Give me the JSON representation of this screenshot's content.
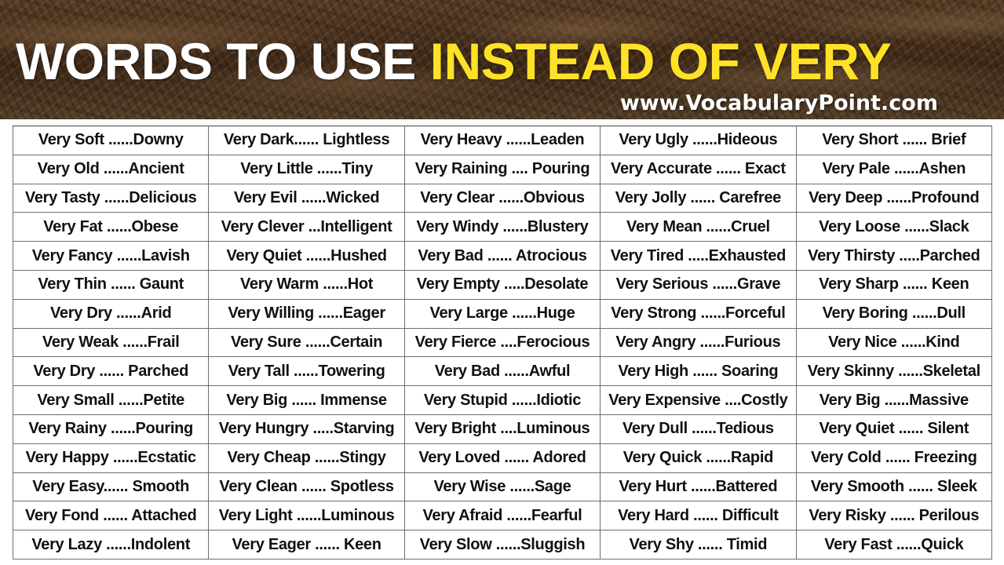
{
  "header": {
    "title_white": "WORDS TO USE",
    "title_yellow": "INSTEAD OF VERY",
    "website": "www.VocabularyPoint.com"
  },
  "colors": {
    "title_white": "#ffffff",
    "title_yellow": "#ffe227",
    "banner_brown": "#4a3220",
    "table_border": "#6e6e6e",
    "text": "#111111"
  },
  "table": {
    "rows": [
      [
        "Very Soft ......Downy",
        "Very Dark...... Lightless",
        "Very Heavy ......Leaden",
        "Very Ugly ......Hideous",
        "Very Short ...... Brief"
      ],
      [
        "Very Old ......Ancient",
        "Very Little ......Tiny",
        "Very Raining .... Pouring",
        "Very Accurate ...... Exact",
        "Very Pale ......Ashen"
      ],
      [
        "Very Tasty ......Delicious",
        "Very Evil ......Wicked",
        "Very Clear ......Obvious",
        "Very Jolly ...... Carefree",
        "Very Deep ......Profound"
      ],
      [
        "Very Fat ......Obese",
        "Very Clever ...Intelligent",
        "Very Windy ......Blustery",
        "Very Mean ......Cruel",
        "Very Loose ......Slack"
      ],
      [
        "Very Fancy ......Lavish",
        "Very Quiet ......Hushed",
        "Very Bad ...... Atrocious",
        "Very Tired .....Exhausted",
        "Very Thirsty .....Parched"
      ],
      [
        "Very Thin ...... Gaunt",
        "Very Warm ......Hot",
        "Very Empty .....Desolate",
        "Very Serious ......Grave",
        "Very Sharp ...... Keen"
      ],
      [
        "Very Dry ......Arid",
        "Very Willing ......Eager",
        "Very Large ......Huge",
        "Very Strong ......Forceful",
        "Very Boring ......Dull"
      ],
      [
        "Very Weak ......Frail",
        "Very Sure ......Certain",
        "Very Fierce ....Ferocious",
        "Very Angry ......Furious",
        "Very Nice ......Kind"
      ],
      [
        "Very Dry ...... Parched",
        "Very Tall ......Towering",
        "Very Bad ......Awful",
        "Very High ...... Soaring",
        "Very Skinny ......Skeletal"
      ],
      [
        "Very Small ......Petite",
        "Very Big ...... Immense",
        "Very Stupid ......Idiotic",
        "Very Expensive ....Costly",
        "Very Big ......Massive"
      ],
      [
        "Very Rainy ......Pouring",
        "Very Hungry .....Starving",
        "Very Bright ....Luminous",
        "Very Dull ......Tedious",
        "Very Quiet ...... Silent"
      ],
      [
        "Very Happy ......Ecstatic",
        "Very Cheap ......Stingy",
        "Very Loved ...... Adored",
        "Very Quick ......Rapid",
        "Very Cold ...... Freezing"
      ],
      [
        "Very Easy...... Smooth",
        "Very Clean ...... Spotless",
        "Very Wise ......Sage",
        "Very Hurt ......Battered",
        "Very Smooth ...... Sleek"
      ],
      [
        "Very Fond ...... Attached",
        "Very Light ......Luminous",
        "Very Afraid ......Fearful",
        "Very Hard ...... Difficult",
        "Very Risky ...... Perilous"
      ],
      [
        "Very Lazy ......Indolent",
        "Very Eager ...... Keen",
        "Very Slow ......Sluggish",
        "Very Shy ...... Timid",
        "Very Fast ......Quick"
      ]
    ]
  }
}
